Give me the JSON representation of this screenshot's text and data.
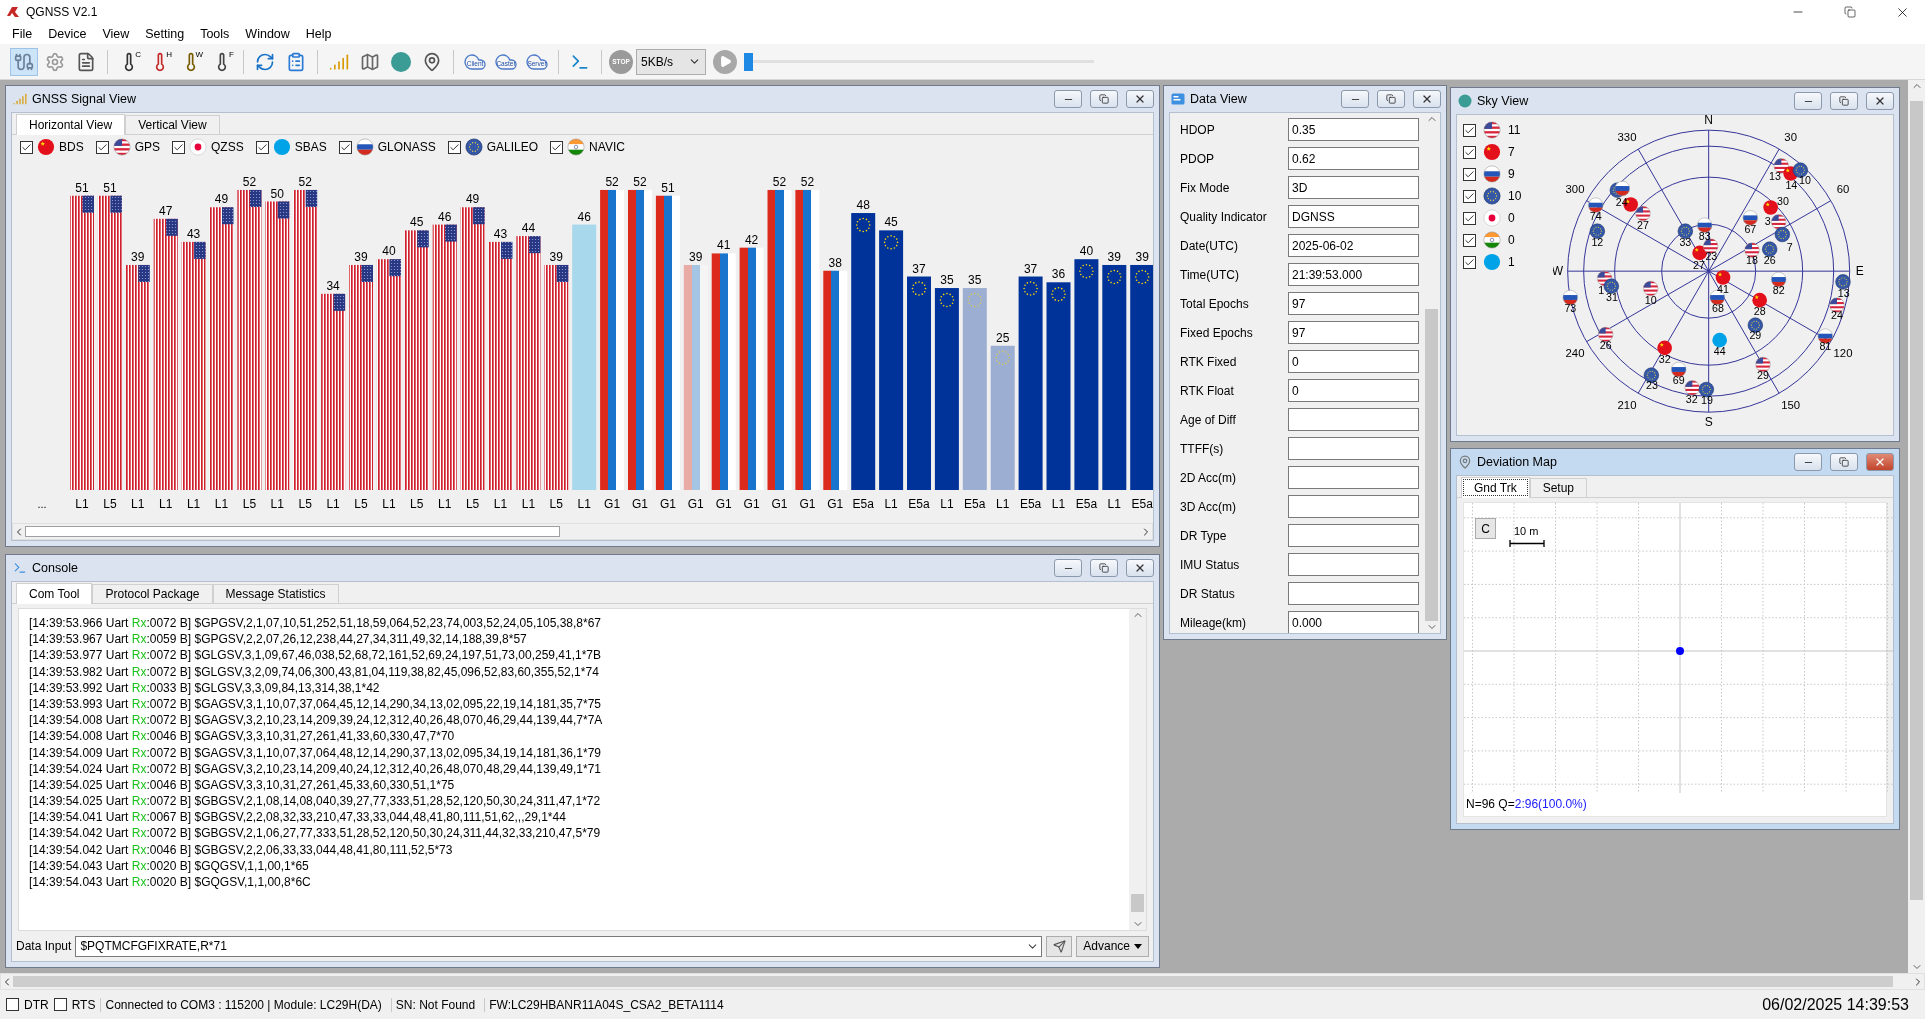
{
  "window": {
    "title": "QGNSS V2.1"
  },
  "menu": [
    "File",
    "Device",
    "View",
    "Setting",
    "Tools",
    "Window",
    "Help"
  ],
  "toolbar": {
    "temperature_units": [
      "C",
      "H",
      "W",
      "F"
    ],
    "cloud_buttons": [
      "Client",
      "Caster",
      "Server"
    ],
    "stop": "STOP",
    "rate": "5KB/s",
    "playback": {
      "level": 0
    }
  },
  "signal_view": {
    "title": "GNSS Signal View",
    "active": false,
    "tabs": [
      {
        "label": "Horizontal View",
        "selected": true
      },
      {
        "label": "Vertical View",
        "selected": false
      }
    ],
    "systems": [
      {
        "kind": "bds",
        "label": "BDS",
        "checked": true
      },
      {
        "kind": "gps",
        "label": "GPS",
        "checked": true
      },
      {
        "kind": "qzss",
        "label": "QZSS",
        "checked": true
      },
      {
        "kind": "sbas",
        "label": "SBAS",
        "checked": true
      },
      {
        "kind": "glonass",
        "label": "GLONASS",
        "checked": true
      },
      {
        "kind": "galileo",
        "label": "GALILEO",
        "checked": true
      },
      {
        "kind": "navic",
        "label": "NAVIC",
        "checked": true
      }
    ],
    "axis_more": "...",
    "chart_data": {
      "type": "bar",
      "data_labels": true,
      "categories": [
        "L1",
        "L5",
        "L1",
        "L1",
        "L1",
        "L1",
        "L5",
        "L1",
        "L5",
        "L1",
        "L5",
        "L1",
        "L5",
        "L1",
        "L5",
        "L1",
        "L1",
        "L5",
        "L1",
        "G1",
        "G1",
        "G1",
        "G1",
        "G1",
        "G1",
        "G1",
        "G1",
        "G1",
        "E5a",
        "L1",
        "E5a",
        "L1",
        "E5a",
        "L1",
        "E5a",
        "L1",
        "E5a",
        "L1",
        "E5a"
      ],
      "series": [
        {
          "color": "#d0202e",
          "values": [
            51,
            51,
            39,
            47,
            43,
            49,
            52,
            50,
            52,
            34,
            39,
            40,
            45,
            46,
            49,
            43,
            44,
            39,
            null,
            null,
            null,
            null,
            null,
            null,
            null,
            null,
            null,
            null,
            null,
            null,
            null,
            null,
            null,
            null,
            null,
            null,
            null,
            null,
            null
          ]
        },
        {
          "color": "#a8d8ec",
          "values": [
            null,
            null,
            null,
            null,
            null,
            null,
            null,
            null,
            null,
            null,
            null,
            null,
            null,
            null,
            null,
            null,
            null,
            null,
            46,
            null,
            null,
            null,
            null,
            null,
            null,
            null,
            null,
            null,
            null,
            null,
            null,
            null,
            null,
            null,
            null,
            null,
            null,
            null,
            null
          ]
        },
        {
          "color": "#dc2a1c",
          "values": [
            null,
            null,
            null,
            null,
            null,
            null,
            null,
            null,
            null,
            null,
            null,
            null,
            null,
            null,
            null,
            null,
            null,
            null,
            null,
            52,
            52,
            51,
            39,
            41,
            42,
            52,
            52,
            38,
            null,
            null,
            null,
            null,
            null,
            null,
            null,
            null,
            null,
            null,
            null
          ]
        },
        {
          "color": "#003399",
          "values": [
            null,
            null,
            null,
            null,
            null,
            null,
            null,
            null,
            null,
            null,
            null,
            null,
            null,
            null,
            null,
            null,
            null,
            null,
            null,
            null,
            null,
            null,
            null,
            null,
            null,
            null,
            null,
            null,
            48,
            45,
            37,
            35,
            35,
            25,
            37,
            36,
            40,
            39,
            39
          ]
        }
      ]
    },
    "bars": [
      {
        "used": true
      },
      {
        "used": true
      },
      {
        "used": true
      },
      {
        "used": true
      },
      {
        "used": true
      },
      {
        "used": true
      },
      {
        "used": true
      },
      {
        "used": true
      },
      {
        "used": true
      },
      {
        "used": true
      },
      {
        "used": true
      },
      {
        "used": true
      },
      {
        "used": true
      },
      {
        "used": true
      },
      {
        "used": true
      },
      {
        "used": true
      },
      {
        "used": true
      },
      {
        "used": true
      },
      {
        "used": true
      },
      {
        "used": true
      },
      {
        "used": true
      },
      {
        "used": true
      },
      {
        "used": false
      },
      {
        "used": true
      },
      {
        "used": true
      },
      {
        "used": true
      },
      {
        "used": true
      },
      {
        "used": true
      },
      {
        "used": true
      },
      {
        "used": true
      },
      {
        "used": true
      },
      {
        "used": true
      },
      {
        "used": false
      },
      {
        "used": false
      },
      {
        "used": true
      },
      {
        "used": true
      },
      {
        "used": true
      },
      {
        "used": true
      },
      {
        "used": true
      }
    ]
  },
  "data_view": {
    "title": "Data View",
    "active": false,
    "rows": [
      {
        "label": "HDOP",
        "value": "0.35"
      },
      {
        "label": "PDOP",
        "value": "0.62"
      },
      {
        "label": "Fix Mode",
        "value": "3D"
      },
      {
        "label": "Quality Indicator",
        "value": "DGNSS"
      },
      {
        "label": "Date(UTC)",
        "value": "2025-06-02"
      },
      {
        "label": "Time(UTC)",
        "value": "21:39:53.000"
      },
      {
        "label": "Total Epochs",
        "value": "97"
      },
      {
        "label": "Fixed Epochs",
        "value": "97"
      },
      {
        "label": "RTK Fixed",
        "value": "0"
      },
      {
        "label": "RTK Float",
        "value": "0"
      },
      {
        "label": "Age of Diff"
      },
      {
        "label": "TTFF(s)"
      },
      {
        "label": "2D Acc(m)"
      },
      {
        "label": "3D Acc(m)"
      },
      {
        "label": "DR Type"
      },
      {
        "label": "IMU Status"
      },
      {
        "label": "DR Status"
      },
      {
        "label": "Mileage(km)",
        "value": "0.000"
      }
    ]
  },
  "sky_view": {
    "title": "Sky View",
    "active": false,
    "legend": [
      {
        "kind": "gps",
        "checked": true,
        "count": "11"
      },
      {
        "kind": "bds",
        "checked": true,
        "count": "7"
      },
      {
        "kind": "glonass",
        "checked": true,
        "count": "9"
      },
      {
        "kind": "galileo",
        "checked": true,
        "count": "10"
      },
      {
        "kind": "qzss",
        "checked": true,
        "count": "0"
      },
      {
        "kind": "navic",
        "checked": true,
        "count": "0"
      },
      {
        "kind": "sbas",
        "checked": true,
        "count": "1"
      }
    ],
    "directions": [
      "N",
      "E",
      "S",
      "W"
    ],
    "azimuths": [
      "30",
      "60",
      "120",
      "150",
      "210",
      "240",
      "300",
      "330"
    ],
    "satellites": [
      {
        "kind": "gps",
        "prn": "13"
      },
      {
        "kind": "bds",
        "prn": "14"
      },
      {
        "kind": "galileo",
        "prn": "10"
      },
      {
        "kind": "galileo"
      },
      {
        "kind": "glonass"
      },
      {
        "kind": "glonass",
        "prn": "74"
      },
      {
        "kind": "bds",
        "prn": "24"
      },
      {
        "kind": "bds",
        "prn": "30"
      },
      {
        "kind": "gps",
        "prn": "27"
      },
      {
        "kind": "glonass",
        "prn": "67"
      },
      {
        "kind": "glonass",
        "prn": "83"
      },
      {
        "kind": "gps",
        "prn": "3"
      },
      {
        "kind": "galileo",
        "prn": "12"
      },
      {
        "kind": "galileo",
        "prn": "33"
      },
      {
        "kind": "galileo",
        "prn": "7"
      },
      {
        "kind": "bds",
        "prn": "27"
      },
      {
        "kind": "gps",
        "prn": "23"
      },
      {
        "kind": "gps",
        "prn": "18"
      },
      {
        "kind": "galileo",
        "prn": "26"
      },
      {
        "kind": "gps",
        "prn": "1"
      },
      {
        "kind": "bds",
        "prn": "41"
      },
      {
        "kind": "glonass",
        "prn": "82"
      },
      {
        "kind": "galileo",
        "prn": "13"
      },
      {
        "kind": "galileo",
        "prn": "31"
      },
      {
        "kind": "gps",
        "prn": "10"
      },
      {
        "kind": "glonass",
        "prn": "73"
      },
      {
        "kind": "glonass",
        "prn": "68"
      },
      {
        "kind": "bds",
        "prn": "28"
      },
      {
        "kind": "gps",
        "prn": "24"
      },
      {
        "kind": "galileo",
        "prn": "29"
      },
      {
        "kind": "gps",
        "prn": "26"
      },
      {
        "kind": "sbas",
        "prn": "44"
      },
      {
        "kind": "glonass",
        "prn": "81"
      },
      {
        "kind": "bds",
        "prn": "32"
      },
      {
        "kind": "glonass",
        "prn": "69"
      },
      {
        "kind": "gps",
        "prn": "29"
      },
      {
        "kind": "galileo",
        "prn": "23"
      },
      {
        "kind": "gps",
        "prn": "32"
      },
      {
        "kind": "galileo",
        "prn": "19"
      }
    ]
  },
  "deviation_map": {
    "title": "Deviation Map",
    "active": true,
    "tabs": [
      {
        "label": "Gnd Trk",
        "selected": true
      },
      {
        "label": "Setup",
        "selected": false
      }
    ],
    "clear_button": "C",
    "scale": "10 m",
    "count": "N=96 Q=",
    "quality": "2:96(100.0%)"
  },
  "console": {
    "title": "Console",
    "active": false,
    "tabs": [
      {
        "label": "Com Tool",
        "selected": true
      },
      {
        "label": "Protocol Package",
        "selected": false
      },
      {
        "label": "Message Statistics",
        "selected": false
      }
    ],
    "lines": [
      {
        "prefix": "[14:39:53.966 Uart ",
        "direction": "Rx",
        "payload": ":0072 B] $GPGSV,2,1,07,10,51,252,51,18,59,064,52,23,74,003,52,24,05,105,38,8*67"
      },
      {
        "prefix": "[14:39:53.967 Uart ",
        "direction": "Rx",
        "payload": ":0059 B] $GPGSV,2,2,07,26,12,238,44,27,34,311,49,32,14,188,39,8*57"
      },
      {
        "prefix": "[14:39:53.977 Uart ",
        "direction": "Rx",
        "payload": ":0072 B] $GLGSV,3,1,09,67,46,038,52,68,72,161,52,69,24,197,51,73,00,259,41,1*7B"
      },
      {
        "prefix": "[14:39:53.982 Uart ",
        "direction": "Rx",
        "payload": ":0072 B] $GLGSV,3,2,09,74,06,300,43,81,04,119,38,82,45,096,52,83,60,355,52,1*74"
      },
      {
        "prefix": "[14:39:53.992 Uart ",
        "direction": "Rx",
        "payload": ":0033 B] $GLGSV,3,3,09,84,13,314,38,1*42"
      },
      {
        "prefix": "[14:39:53.993 Uart ",
        "direction": "Rx",
        "payload": ":0072 B] $GAGSV,3,1,10,07,37,064,45,12,14,290,34,13,02,095,22,19,14,181,35,7*75"
      },
      {
        "prefix": "[14:39:54.008 Uart ",
        "direction": "Rx",
        "payload": ":0072 B] $GAGSV,3,2,10,23,14,209,39,24,12,312,40,26,48,070,46,29,44,139,44,7*7A"
      },
      {
        "prefix": "[14:39:54.008 Uart ",
        "direction": "Rx",
        "payload": ":0046 B] $GAGSV,3,3,10,31,27,261,41,33,60,330,47,7*70"
      },
      {
        "prefix": "[14:39:54.009 Uart ",
        "direction": "Rx",
        "payload": ":0072 B] $GAGSV,3,1,10,07,37,064,48,12,14,290,37,13,02,095,34,19,14,181,36,1*79"
      },
      {
        "prefix": "[14:39:54.024 Uart ",
        "direction": "Rx",
        "payload": ":0072 B] $GAGSV,3,2,10,23,14,209,40,24,12,312,40,26,48,070,48,29,44,139,49,1*71"
      },
      {
        "prefix": "[14:39:54.025 Uart ",
        "direction": "Rx",
        "payload": ":0046 B] $GAGSV,3,3,10,31,27,261,45,33,60,330,51,1*75"
      },
      {
        "prefix": "[14:39:54.025 Uart ",
        "direction": "Rx",
        "payload": ":0072 B] $GBGSV,2,1,08,14,08,040,39,27,77,333,51,28,52,120,50,30,24,311,47,1*72"
      },
      {
        "prefix": "[14:39:54.041 Uart ",
        "direction": "Rx",
        "payload": ":0067 B] $GBGSV,2,2,08,32,33,210,47,33,33,044,48,41,80,111,51,62,,,29,1*44"
      },
      {
        "prefix": "[14:39:54.042 Uart ",
        "direction": "Rx",
        "payload": ":0072 B] $GBGSV,2,1,06,27,77,333,51,28,52,120,50,30,24,311,44,32,33,210,47,5*79"
      },
      {
        "prefix": "[14:39:54.042 Uart ",
        "direction": "Rx",
        "payload": ":0046 B] $GBGSV,2,2,06,33,33,044,48,41,80,111,52,5*73"
      },
      {
        "prefix": "[14:39:54.043 Uart ",
        "direction": "Rx",
        "payload": ":0020 B] $GQGSV,1,1,00,1*65"
      },
      {
        "prefix": "[14:39:54.043 Uart ",
        "direction": "Rx",
        "payload": ":0020 B] $GQGSV,1,1,00,8*6C"
      }
    ],
    "input_label": "Data Input",
    "input_value": "$PQTMCFGFIXRATE,R*71",
    "advance": "Advance"
  },
  "status_bar": {
    "dtr": {
      "label": "DTR",
      "checked": false
    },
    "rts": {
      "label": "RTS",
      "checked": false
    },
    "segments": [
      "Connected to COM3 : 115200 | Module: LC29H(DA)",
      "SN: Not Found",
      "FW:LC29HBANR11A04S_CSA2_BETA1114"
    ],
    "datetime": "06/02/2025 14:39:53"
  }
}
